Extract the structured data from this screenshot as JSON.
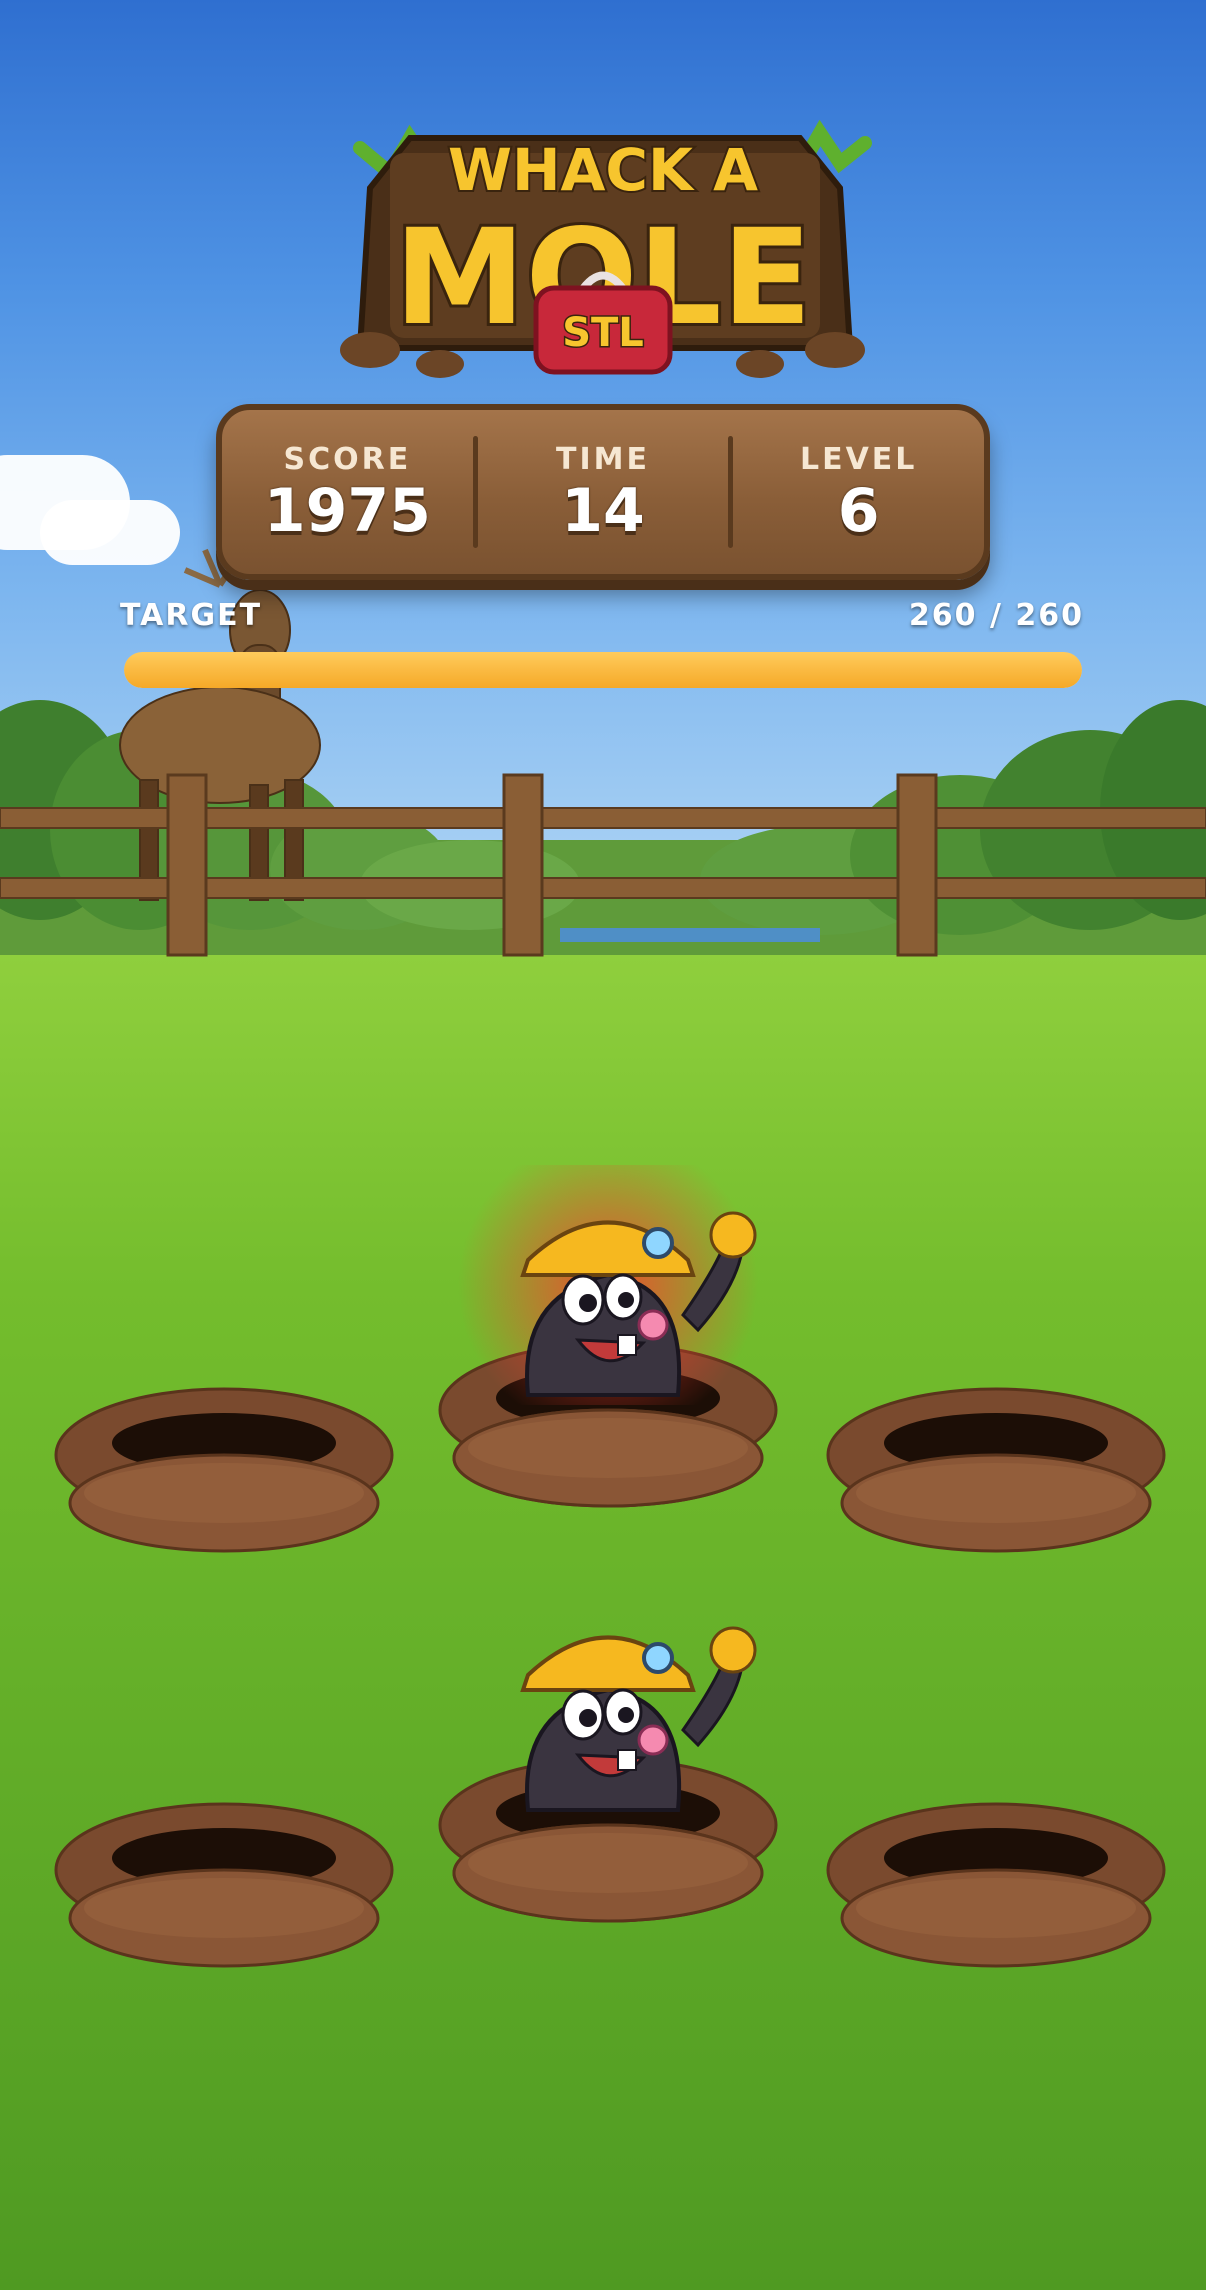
{
  "game": {
    "title_line1": "WHACK A",
    "title_line2": "MOLE",
    "badge": "STL"
  },
  "stats": {
    "score_label": "SCORE",
    "score_value": "1975",
    "time_label": "TIME",
    "time_value": "14",
    "level_label": "LEVEL",
    "level_value": "6"
  },
  "target": {
    "label": "TARGET",
    "count": "260 / 260",
    "progress_fraction": 1.0
  },
  "holes": [
    {
      "row": 1,
      "col": 1,
      "mole": false
    },
    {
      "row": 1,
      "col": 2,
      "mole": true,
      "highlighted": true
    },
    {
      "row": 1,
      "col": 3,
      "mole": false
    },
    {
      "row": 2,
      "col": 1,
      "mole": false
    },
    {
      "row": 2,
      "col": 2,
      "mole": true,
      "highlighted": false
    },
    {
      "row": 2,
      "col": 3,
      "mole": false
    }
  ],
  "colors": {
    "sky": "#4f93e4",
    "grass": "#74bd2d",
    "panel": "#8a5e38",
    "progress": "#f5a928",
    "logo_text": "#f7c52e",
    "badge": "#c8283a"
  }
}
